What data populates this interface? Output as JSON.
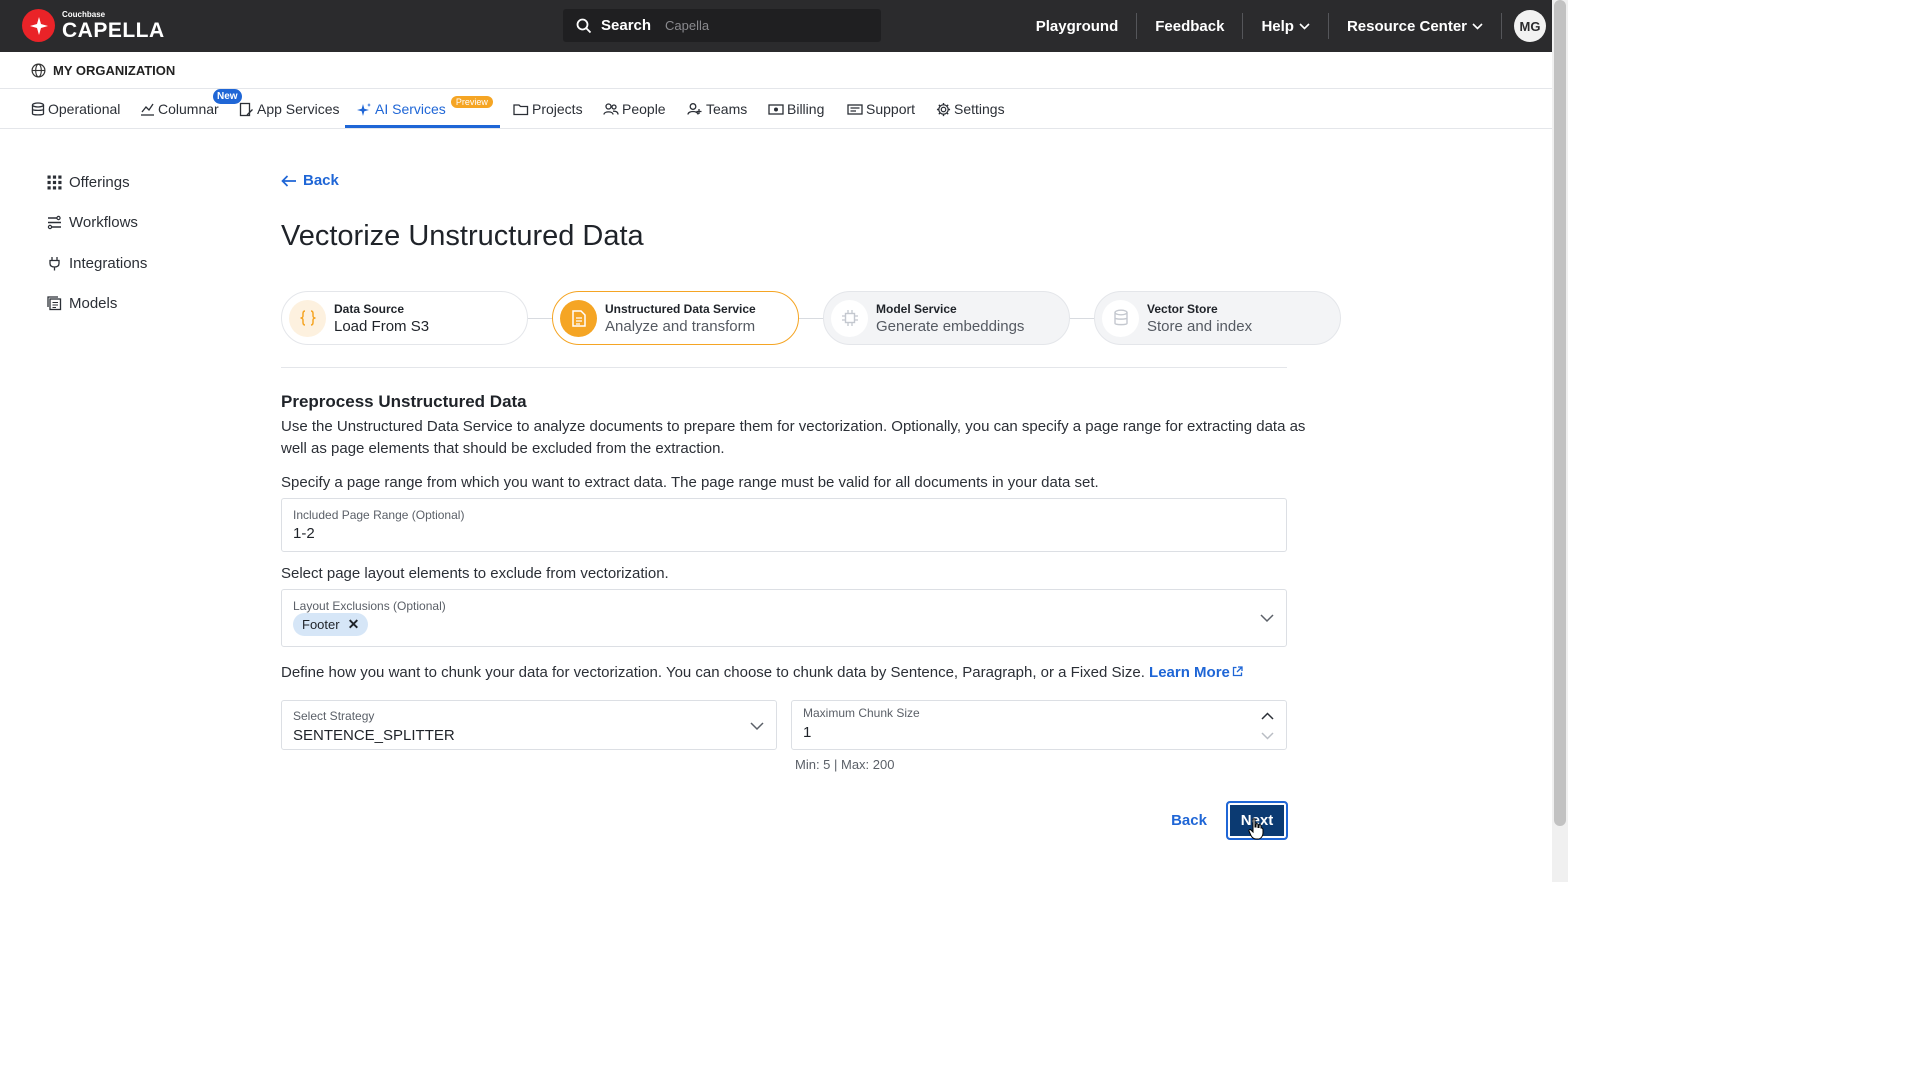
{
  "brand": {
    "small": "Couchbase",
    "name": "CAPELLA"
  },
  "search": {
    "label": "Search",
    "placeholder": "Capella"
  },
  "topnav": {
    "playground": "Playground",
    "feedback": "Feedback",
    "help": "Help",
    "resource_center": "Resource Center",
    "avatar": "MG"
  },
  "org": {
    "label": "MY ORGANIZATION"
  },
  "tabs": [
    {
      "label": "Operational"
    },
    {
      "label": "Columnar",
      "badge": "New"
    },
    {
      "label": "App Services"
    },
    {
      "label": "AI Services",
      "badge": "Preview"
    },
    {
      "label": "Projects"
    },
    {
      "label": "People"
    },
    {
      "label": "Teams"
    },
    {
      "label": "Billing"
    },
    {
      "label": "Support"
    },
    {
      "label": "Settings"
    }
  ],
  "sidebar": {
    "items": [
      {
        "label": "Offerings"
      },
      {
        "label": "Workflows"
      },
      {
        "label": "Integrations"
      },
      {
        "label": "Models"
      }
    ]
  },
  "page": {
    "back": "Back",
    "title": "Vectorize Unstructured Data"
  },
  "steps": [
    {
      "title": "Data Source",
      "subtitle": "Load From S3"
    },
    {
      "title": "Unstructured Data Service",
      "subtitle": "Analyze and transform"
    },
    {
      "title": "Model Service",
      "subtitle": "Generate embeddings"
    },
    {
      "title": "Vector Store",
      "subtitle": "Store and index"
    }
  ],
  "section": {
    "title": "Preprocess Unstructured Data",
    "intro_line1": "Use the Unstructured Data Service to analyze documents to prepare them for vectorization. Optionally, you can specify a page range for extracting data as",
    "intro_line2": "well as page elements that should be excluded from the extraction.",
    "page_range_help": "Specify a page range from which you want to extract data. The page range must be valid for all documents in your data set.",
    "layout_help": "Select page layout elements to exclude from vectorization.",
    "chunk_help": "Define how you want to chunk your data for vectorization. You can choose to chunk data by Sentence, Paragraph, or a Fixed Size.",
    "learn_more": "Learn More"
  },
  "fields": {
    "page_range": {
      "label": "Included Page Range (Optional)",
      "value": "1-2"
    },
    "layout_exclusions": {
      "label": "Layout Exclusions (Optional)",
      "chips": [
        "Footer"
      ]
    },
    "strategy": {
      "label": "Select Strategy",
      "value": "SENTENCE_SPLITTER"
    },
    "chunk_size": {
      "label": "Maximum Chunk Size",
      "value": "1",
      "hint": "Min: 5 | Max: 200"
    }
  },
  "actions": {
    "back": "Back",
    "next": "Next"
  },
  "colors": {
    "accent": "#1f66d6",
    "step_active": "#f5a524",
    "brand_red": "#ea2328",
    "topbar": "#2b2b2d"
  }
}
